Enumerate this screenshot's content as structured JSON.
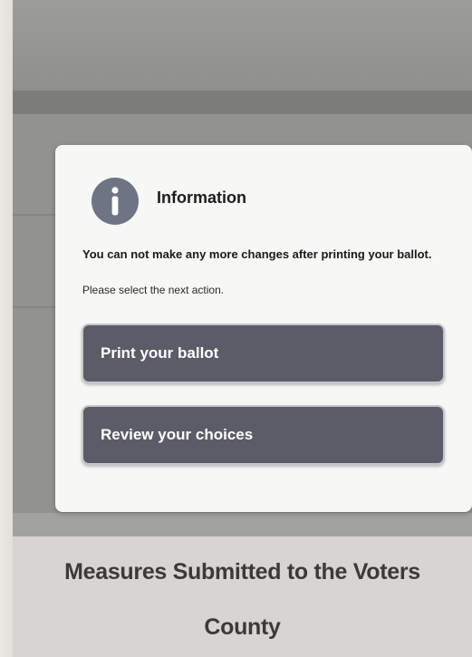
{
  "dialog": {
    "title": "Information",
    "icon": "info-icon",
    "warning": "You can not make any more changes after printing your ballot.",
    "instruction": "Please select the next action.",
    "buttons": {
      "print_label": "Print your ballot",
      "review_label": "Review your choices"
    }
  },
  "background": {
    "section_title_line1": "Measures Submitted to the Voters",
    "section_title_line2": "County"
  },
  "colors": {
    "button_bg": "#5b5c68",
    "button_border": "#c4c6cf",
    "icon_bg": "#6f7485",
    "dialog_bg": "#f7f7f5",
    "overlay": "#929391"
  }
}
